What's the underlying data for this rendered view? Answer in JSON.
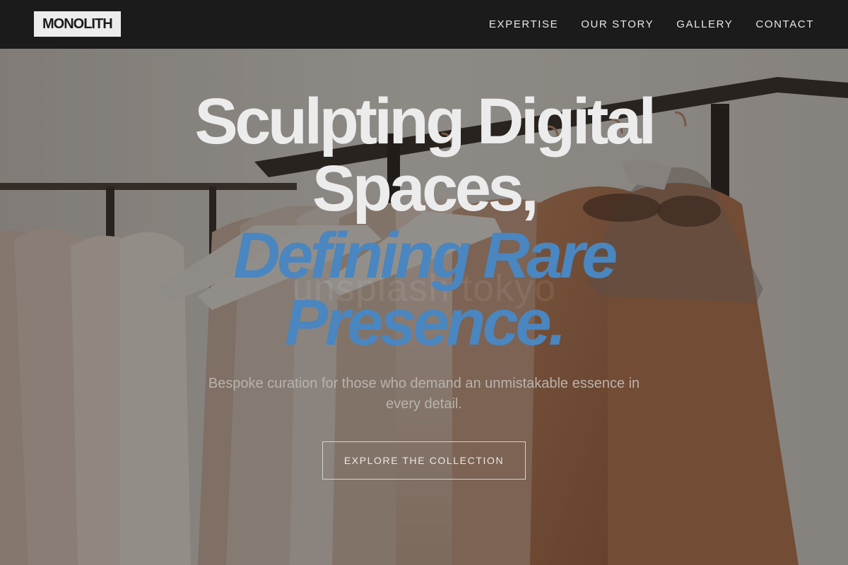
{
  "nav": {
    "logo": "MONOLITH",
    "links": [
      {
        "label": "EXPERTISE"
      },
      {
        "label": "OUR STORY"
      },
      {
        "label": "GALLERY"
      },
      {
        "label": "CONTACT"
      }
    ]
  },
  "hero": {
    "headline_line1": "Sculpting Digital",
    "headline_line2": "Spaces,",
    "headline_line3": "Defining Rare",
    "headline_line4": "Presence.",
    "subtitle": "Bespoke curation for those who demand an unmistakable essence in every detail.",
    "cta_label": "EXPLORE THE COLLECTION",
    "watermark": "unsplash tokyo"
  },
  "colors": {
    "navbar": "#1b1b1b",
    "accent": "#4a86c0",
    "headline": "#ececec"
  }
}
